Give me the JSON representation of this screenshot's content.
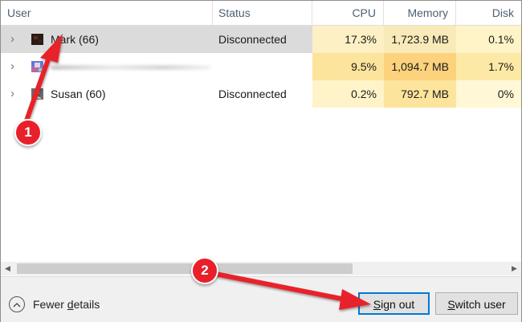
{
  "columns": {
    "user": "User",
    "status": "Status",
    "cpu": "CPU",
    "memory": "Memory",
    "disk": "Disk"
  },
  "rows": [
    {
      "name": "Mark (66)",
      "status": "Disconnected",
      "cpu": "17.3%",
      "memory": "1,723.9 MB",
      "disk": "0.1%",
      "selected": true,
      "avatar": "dark-user-avatar"
    },
    {
      "name": "",
      "status": "",
      "cpu": "9.5%",
      "memory": "1,094.7 MB",
      "disk": "1.7%",
      "selected": false,
      "avatar": "colorful-user-avatar"
    },
    {
      "name": "Susan (60)",
      "status": "Disconnected",
      "cpu": "0.2%",
      "memory": "792.7 MB",
      "disk": "0%",
      "selected": false,
      "avatar": "default-user-avatar"
    }
  ],
  "footer": {
    "fewer_details_pre": "Fewer ",
    "fewer_details_access": "d",
    "fewer_details_post": "etails",
    "sign_out_access": "S",
    "sign_out_post": "ign out",
    "switch_user_access": "S",
    "switch_user_post": "witch user"
  },
  "annotations": {
    "badge1": "1",
    "badge2": "2"
  },
  "colors": {
    "cpu_row1": "#fdf0c4",
    "cpu_row2": "#fde49c",
    "cpu_row3": "#fff3c9",
    "mem_row1": "#f9eab9",
    "mem_row2": "#fcd27d",
    "mem_row3": "#fde49c",
    "disk_row1": "#fff4c8",
    "disk_row2": "#fde9a6",
    "disk_row3": "#fff7d6",
    "selection": "#dbdbdb",
    "annotation_red": "#e8202a"
  }
}
